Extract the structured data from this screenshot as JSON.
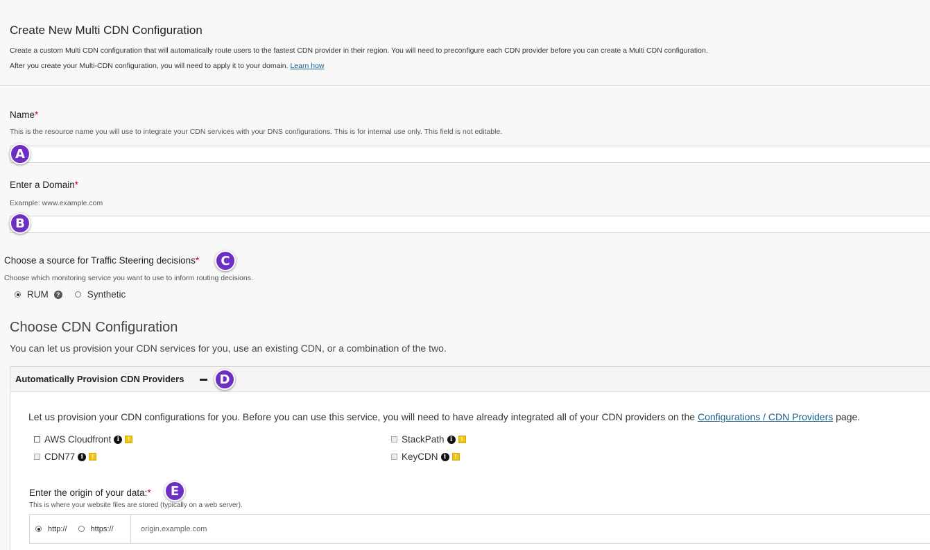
{
  "header": {
    "title": "Create New Multi CDN Configuration",
    "line1": "Create a custom Multi CDN configuration that will automatically route users to the fastest CDN provider in their region. You will need to preconfigure each CDN provider before you can create a Multi CDN configuration.",
    "line2": "After you create your Multi-CDN configuration, you will need to apply it to your domain.",
    "learn_link": "Learn how"
  },
  "name_field": {
    "label": "Name",
    "required": "*",
    "help": "This is the resource name you will use to integrate your CDN services with your DNS configurations. This is for internal use only. This field is not editable.",
    "value": ""
  },
  "domain_field": {
    "label": "Enter a Domain",
    "required": "*",
    "help": "Example: www.example.com",
    "value": ""
  },
  "steering": {
    "label": "Choose a source for Traffic Steering decisions",
    "required": "*",
    "help": "Choose which monitoring service you want to use to inform routing decisions.",
    "options": [
      {
        "label": "RUM",
        "selected": true
      },
      {
        "label": "Synthetic",
        "selected": false
      }
    ]
  },
  "cdn_config": {
    "title": "Choose CDN Configuration",
    "subtitle": "You can let us provision your CDN services for you, use an existing CDN, or a combination of the two."
  },
  "auto_panel": {
    "title": "Automatically Provision CDN Providers",
    "text": "Let us provision your CDN configurations for you. Before you can use this service, you will need to have already integrated all of your CDN providers on the",
    "link": "Configurations / CDN Providers",
    "text_end": "page.",
    "providers": [
      {
        "label": "AWS Cloudfront",
        "enabled": true
      },
      {
        "label": "StackPath",
        "enabled": false
      },
      {
        "label": "CDN77",
        "enabled": false
      },
      {
        "label": "KeyCDN",
        "enabled": false
      }
    ],
    "origin": {
      "label": "Enter the origin of your data:",
      "required": "*",
      "help": "This is where your website files are stored (typically on a web server).",
      "protocols": [
        {
          "label": "http://",
          "selected": true
        },
        {
          "label": "https://",
          "selected": false
        }
      ],
      "placeholder": "origin.example.com"
    }
  },
  "markers": {
    "a": "A",
    "b": "B",
    "c": "C",
    "d": "D",
    "e": "E"
  },
  "colors": {
    "marker": "#6d2fc3",
    "required": "#d0021b",
    "link": "#1a5f8a",
    "warning": "#f0c419"
  }
}
